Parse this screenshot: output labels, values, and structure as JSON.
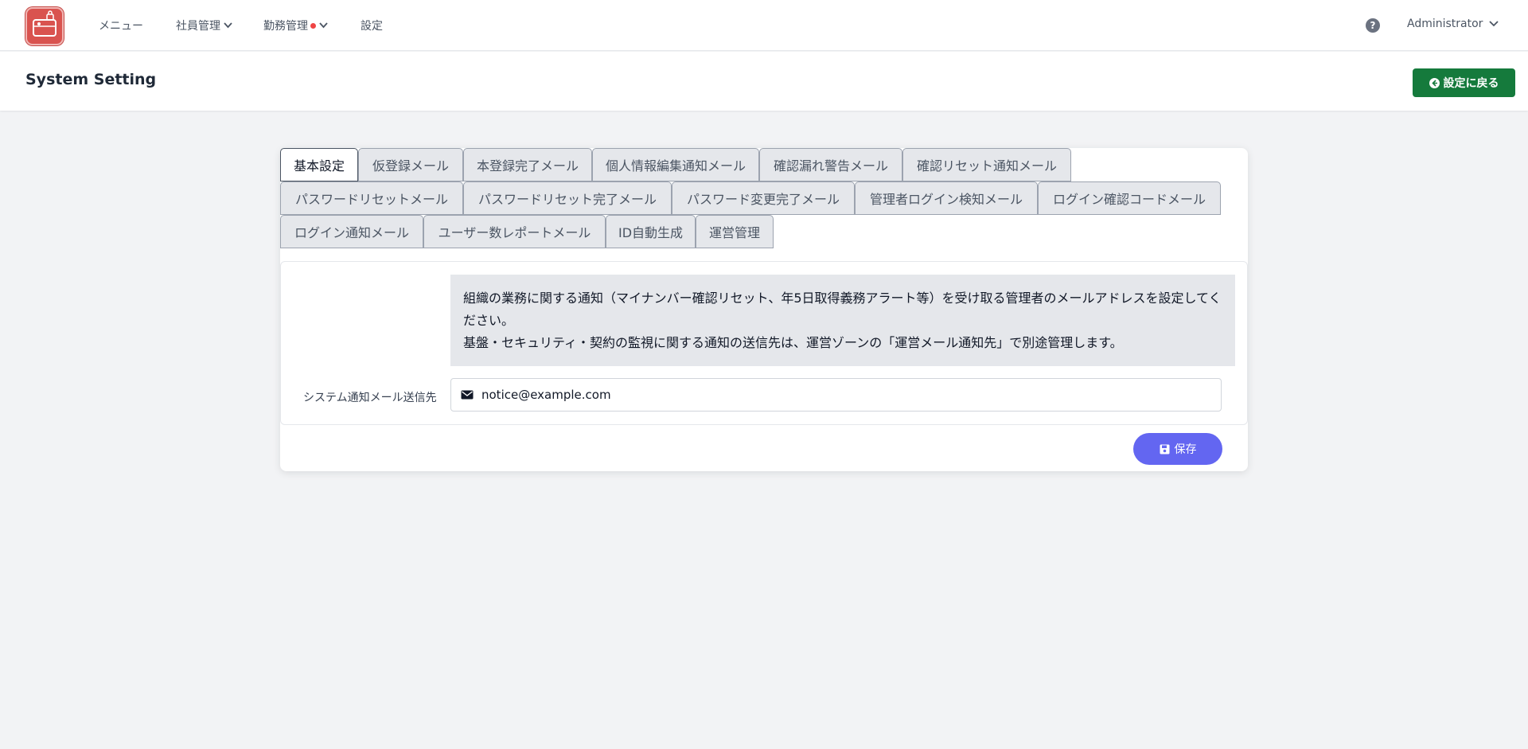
{
  "nav": {
    "items": [
      {
        "label": "メニュー"
      },
      {
        "label": "社員管理"
      },
      {
        "label": "勤務管理"
      },
      {
        "label": "設定"
      }
    ],
    "user": "Administrator"
  },
  "header": {
    "title": "System Setting",
    "back_label": "設定に戻る"
  },
  "tabs": [
    {
      "label": "基本設定",
      "active": true
    },
    {
      "label": "仮登録メール"
    },
    {
      "label": "本登録完了メール"
    },
    {
      "label": "個人情報編集通知メール"
    },
    {
      "label": "確認漏れ警告メール"
    },
    {
      "label": "確認リセット通知メール"
    },
    {
      "label": "パスワードリセットメール"
    },
    {
      "label": "パスワードリセット完了メール"
    },
    {
      "label": "パスワード変更完了メール"
    },
    {
      "label": "管理者ログイン検知メール"
    },
    {
      "label": "ログイン確認コードメール"
    },
    {
      "label": "ログイン通知メール"
    },
    {
      "label": "ユーザー数レポートメール"
    },
    {
      "label": "ID自動生成"
    },
    {
      "label": "運営管理"
    }
  ],
  "notice": {
    "line1": "組織の業務に関する通知（マイナンバー確認リセット、年5日取得義務アラート等）を受け取る管理者のメールアドレスを設定してください。",
    "line2": "基盤・セキュリティ・契約の監視に関する通知の送信先は、運営ゾーンの「運営メール通知先」で別途管理します。"
  },
  "form": {
    "label": "システム通知メール送信先",
    "value": "notice@example.com"
  },
  "save_label": "保存",
  "colors": {
    "back_button": "#157a3c",
    "save_button": "#6366f1",
    "logo": "#d9534f",
    "alert_dot": "#ef4444"
  }
}
